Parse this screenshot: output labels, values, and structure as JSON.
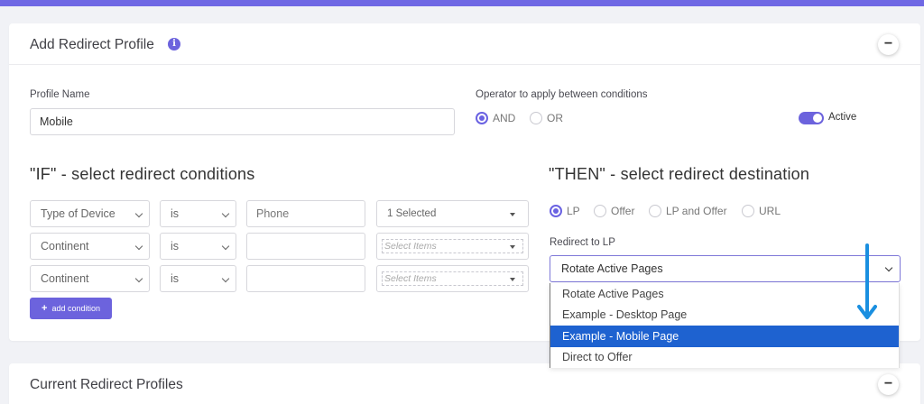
{
  "add_profile": {
    "title": "Add Redirect Profile",
    "info_icon": "i",
    "collapse_icon": "−",
    "profile_name_label": "Profile Name",
    "profile_name_value": "Mobile",
    "operator_label": "Operator to apply between conditions",
    "operators": [
      {
        "label": "AND",
        "checked": true
      },
      {
        "label": "OR",
        "checked": false
      }
    ],
    "active_label": "Active",
    "active_on": true,
    "if_title": "\"IF\" - select redirect conditions",
    "conditions": [
      {
        "type": "Type of Device",
        "operator": "is",
        "value": "Phone",
        "select": "1 Selected"
      },
      {
        "type": "Continent",
        "operator": "is",
        "value": "",
        "select": "Select Items"
      },
      {
        "type": "Continent",
        "operator": "is",
        "value": "",
        "select": "Select Items"
      }
    ],
    "add_condition_label": "add condition",
    "then_title": "\"THEN\" - select redirect destination",
    "destinations": [
      {
        "label": "LP",
        "checked": true
      },
      {
        "label": "Offer",
        "checked": false
      },
      {
        "label": "LP and Offer",
        "checked": false
      },
      {
        "label": "URL",
        "checked": false
      }
    ],
    "redirect_to_label": "Redirect to LP",
    "redirect_to_value": "Rotate Active Pages",
    "dropdown_options": [
      {
        "label": "Rotate Active Pages",
        "selected": false
      },
      {
        "label": "Example - Desktop Page",
        "selected": false
      },
      {
        "label": "Example - Mobile Page",
        "selected": true
      },
      {
        "label": "Direct to Offer",
        "selected": false
      }
    ]
  },
  "current_profiles": {
    "title": "Current Redirect Profiles",
    "collapse_icon": "−"
  },
  "colors": {
    "accent": "#6c63dd",
    "highlight": "#1e62d0",
    "arrow": "#1a8fe0"
  }
}
